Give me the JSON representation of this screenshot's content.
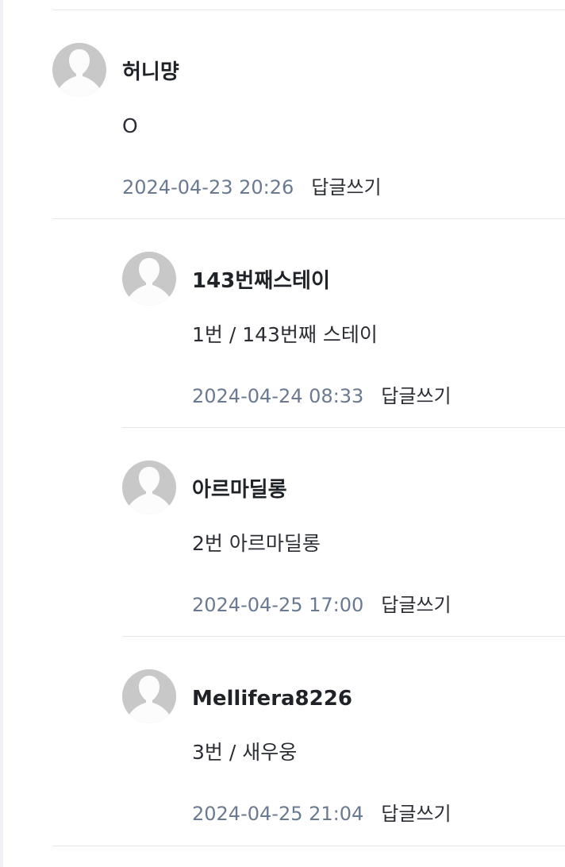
{
  "comments": [
    {
      "author": "허니먕",
      "text": "O",
      "date": "2024-04-23 20:26",
      "reply_label": "답글쓰기",
      "avatar_icon": "default-user-icon"
    },
    {
      "author": "143번째스테이",
      "text": "1번 / 143번째 스테이",
      "date": "2024-04-24 08:33",
      "reply_label": "답글쓰기",
      "avatar_icon": "default-user-icon"
    },
    {
      "author": "아르마딜롱",
      "text": "2번 아르마딜롱",
      "date": "2024-04-25 17:00",
      "reply_label": "답글쓰기",
      "avatar_icon": "default-user-icon"
    },
    {
      "author": "Mellifera8226",
      "text": "3번 / 새우웅",
      "date": "2024-04-25 21:04",
      "reply_label": "답글쓰기",
      "avatar_icon": "default-user-icon"
    }
  ],
  "colors": {
    "avatar_bg": "#c8c8c8",
    "date": "#6b7a90",
    "divider": "#e4e7eb"
  }
}
